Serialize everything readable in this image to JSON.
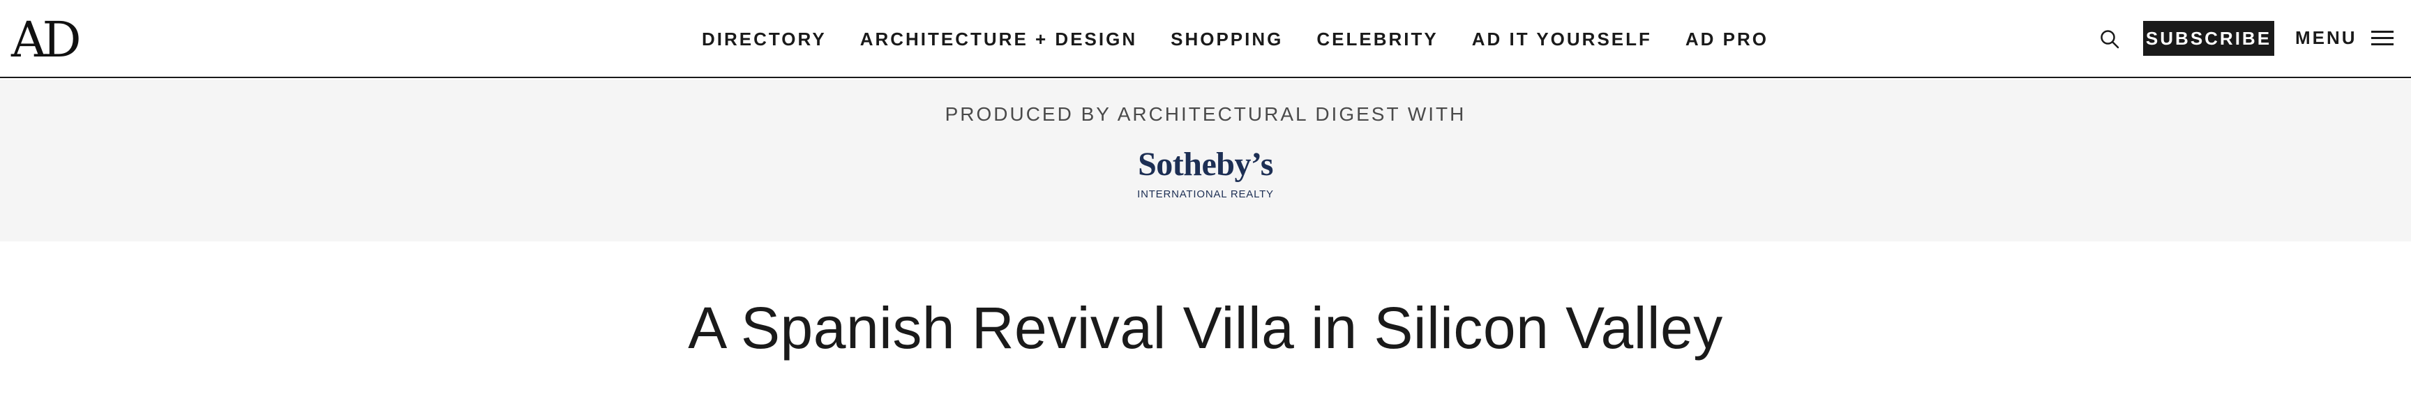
{
  "header": {
    "logo_text": "AD",
    "nav": [
      {
        "label": "DIRECTORY"
      },
      {
        "label": "ARCHITECTURE + DESIGN"
      },
      {
        "label": "SHOPPING"
      },
      {
        "label": "CELEBRITY"
      },
      {
        "label": "AD IT YOURSELF"
      },
      {
        "label": "AD PRO"
      }
    ],
    "search_icon": "search-icon",
    "subscribe_label": "SUBSCRIBE",
    "menu_label": "MENU",
    "menu_icon": "hamburger-icon"
  },
  "sponsor": {
    "label": "PRODUCED BY ARCHITECTURAL DIGEST WITH",
    "brand": "Sotheby’s",
    "brand_sub": "INTERNATIONAL REALTY"
  },
  "article": {
    "headline": "A Spanish Revival Villa in Silicon Valley"
  },
  "colors": {
    "text": "#1a1a1a",
    "band_bg": "#f5f5f5",
    "sponsor_brand": "#1d2f54",
    "button_bg": "#1a1a1a",
    "button_text": "#ffffff"
  }
}
